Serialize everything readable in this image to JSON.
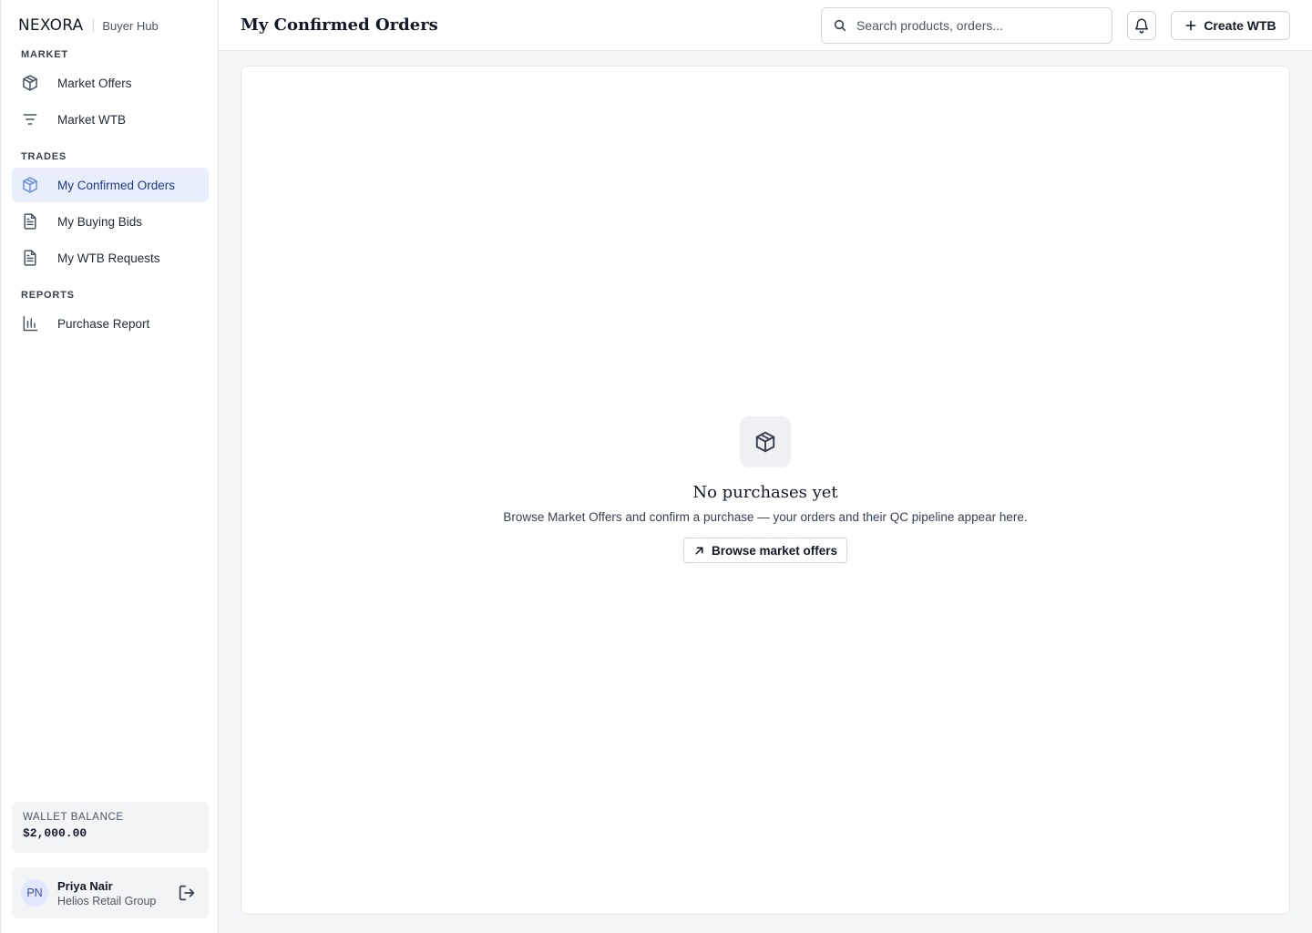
{
  "brand": {
    "logo": "NEXORA",
    "subtitle": "Buyer Hub"
  },
  "sidebar": {
    "sections": [
      {
        "label": "MARKET",
        "items": [
          {
            "label": "Market Offers",
            "icon": "package-icon",
            "active": false
          },
          {
            "label": "Market WTB",
            "icon": "filter-lines-icon",
            "active": false
          }
        ]
      },
      {
        "label": "TRADES",
        "items": [
          {
            "label": "My Confirmed Orders",
            "icon": "package-icon",
            "active": true
          },
          {
            "label": "My Buying Bids",
            "icon": "document-icon",
            "active": false
          },
          {
            "label": "My WTB Requests",
            "icon": "document-icon",
            "active": false
          }
        ]
      },
      {
        "label": "REPORTS",
        "items": [
          {
            "label": "Purchase Report",
            "icon": "bar-chart-icon",
            "active": false
          }
        ]
      }
    ],
    "wallet": {
      "label": "WALLET BALANCE",
      "value": "$2,000.00"
    },
    "user": {
      "initials": "PN",
      "name": "Priya Nair",
      "org": "Helios Retail Group"
    }
  },
  "header": {
    "title": "My Confirmed Orders",
    "search_placeholder": "Search products, orders...",
    "create_label": "Create WTB"
  },
  "empty_state": {
    "icon": "package-icon",
    "title": "No purchases yet",
    "description": "Browse Market Offers and confirm a purchase — your orders and their QC pipeline appear here.",
    "button_label": "Browse market offers"
  },
  "colors": {
    "accent": "#1e3a8a",
    "active_bg": "#e8eefc",
    "border": "#e5e7eb",
    "page_bg": "#f6f7f9"
  }
}
